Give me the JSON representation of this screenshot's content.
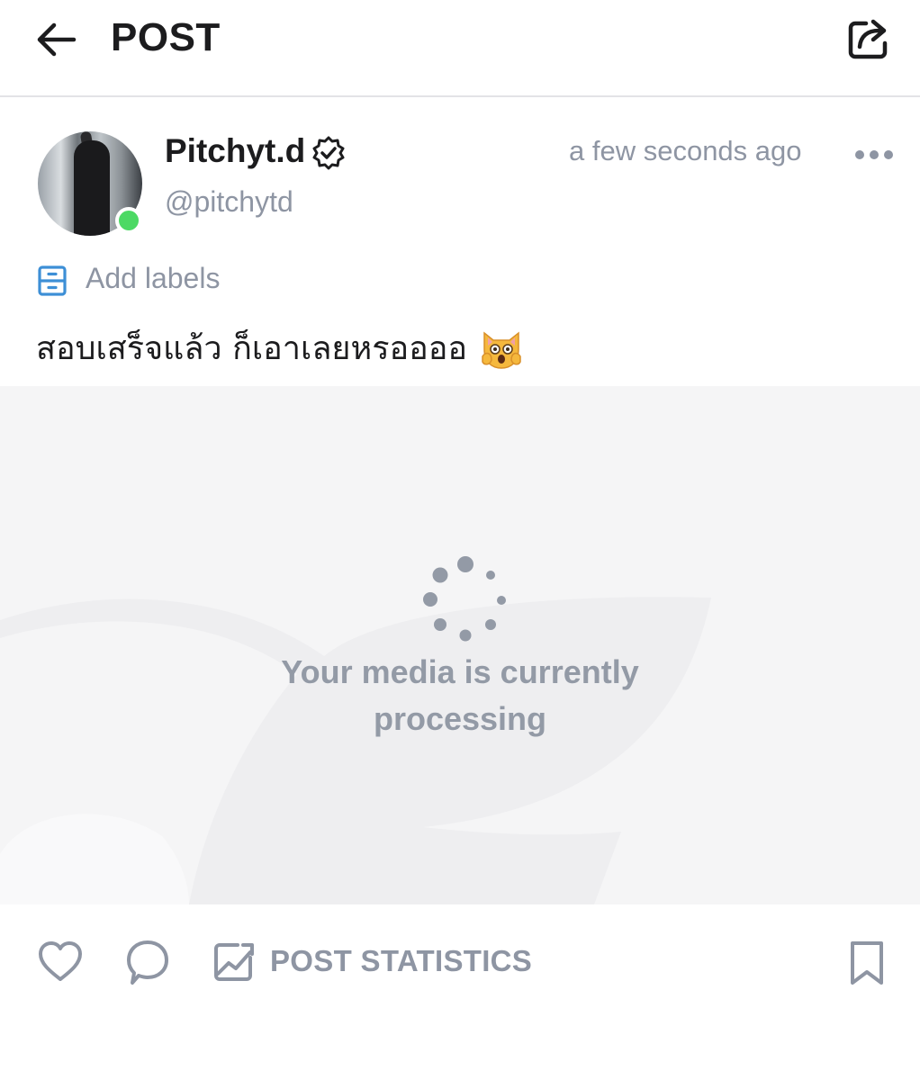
{
  "header": {
    "title": "POST"
  },
  "post": {
    "author": {
      "display_name": "Pitchyt.d",
      "handle": "@pitchytd",
      "verified": true,
      "online": true
    },
    "timestamp": "a few seconds ago",
    "add_labels": "Add labels",
    "text": "สอบเสร็จแล้ว ก็เอาเลยหรออออ",
    "emoji": "weary-cat-face",
    "media_status": "Your media is currently processing"
  },
  "actions": {
    "stats_label": "POST STATISTICS"
  },
  "colors": {
    "accent_blue": "#3d8fd6",
    "muted_gray": "#8e95a3",
    "online_green": "#4cd964",
    "media_bg": "#f5f5f6"
  }
}
